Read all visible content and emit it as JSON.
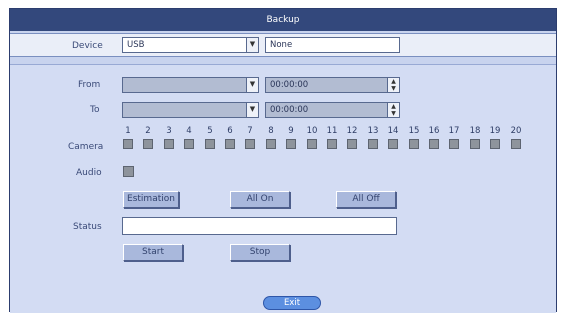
{
  "window": {
    "title": "Backup"
  },
  "device": {
    "label": "Device",
    "source": "USB",
    "target": "None"
  },
  "from": {
    "label": "From",
    "date": "",
    "time": "00:00:00"
  },
  "to": {
    "label": "To",
    "date": "",
    "time": "00:00:00"
  },
  "camera": {
    "label": "Camera",
    "numbers": [
      "1",
      "2",
      "3",
      "4",
      "5",
      "6",
      "7",
      "8",
      "9",
      "10",
      "11",
      "12",
      "13",
      "14",
      "15",
      "16",
      "17",
      "18",
      "19",
      "20"
    ]
  },
  "audio": {
    "label": "Audio"
  },
  "buttons": {
    "estimation": "Estimation",
    "all_on": "All On",
    "all_off": "All Off",
    "start": "Start",
    "stop": "Stop",
    "exit": "Exit"
  },
  "status": {
    "label": "Status",
    "value": ""
  },
  "colors": {
    "title_bar": "#33487c",
    "panel": "#d3dcf3",
    "checkbox": "#8e949c",
    "exit_button": "#5c8fe0"
  }
}
